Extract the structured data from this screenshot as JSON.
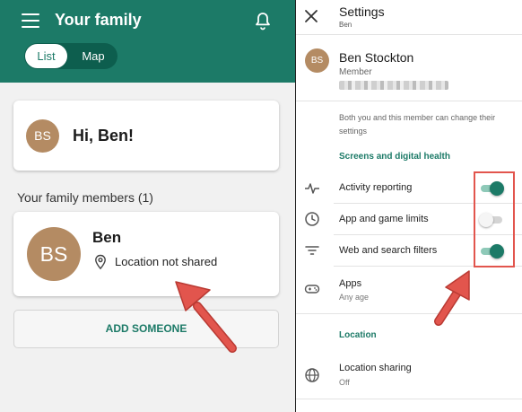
{
  "left": {
    "header": {
      "title": "Your family",
      "tabs": [
        {
          "label": "List",
          "active": true
        },
        {
          "label": "Map",
          "active": false
        }
      ]
    },
    "greeting": {
      "initials": "BS",
      "text": "Hi, Ben!"
    },
    "members_heading": "Your family members (1)",
    "member": {
      "initials": "BS",
      "name": "Ben",
      "location": "Location not shared"
    },
    "add_button": "ADD SOMEONE"
  },
  "right": {
    "title": "Settings",
    "subtitle": "Ben",
    "profile": {
      "initials": "BS",
      "name": "Ben Stockton",
      "role": "Member"
    },
    "info_text": "Both you and this member can change their settings",
    "section_screens": "Screens and digital health",
    "rows": [
      {
        "label": "Activity reporting",
        "icon": "activity-pulse-icon",
        "enabled": true
      },
      {
        "label": "App and game limits",
        "icon": "clock-icon",
        "enabled": false
      },
      {
        "label": "Web and search filters",
        "icon": "filter-icon",
        "enabled": true
      }
    ],
    "apps": {
      "label": "Apps",
      "sub": "Any age",
      "icon": "gamepad-icon"
    },
    "section_location": "Location",
    "location_sharing": {
      "label": "Location sharing",
      "sub": "Off",
      "icon": "globe-icon"
    }
  },
  "colors": {
    "brand": "#1c7a67",
    "avatar": "#b48b63",
    "annotation": "#e2554d"
  }
}
